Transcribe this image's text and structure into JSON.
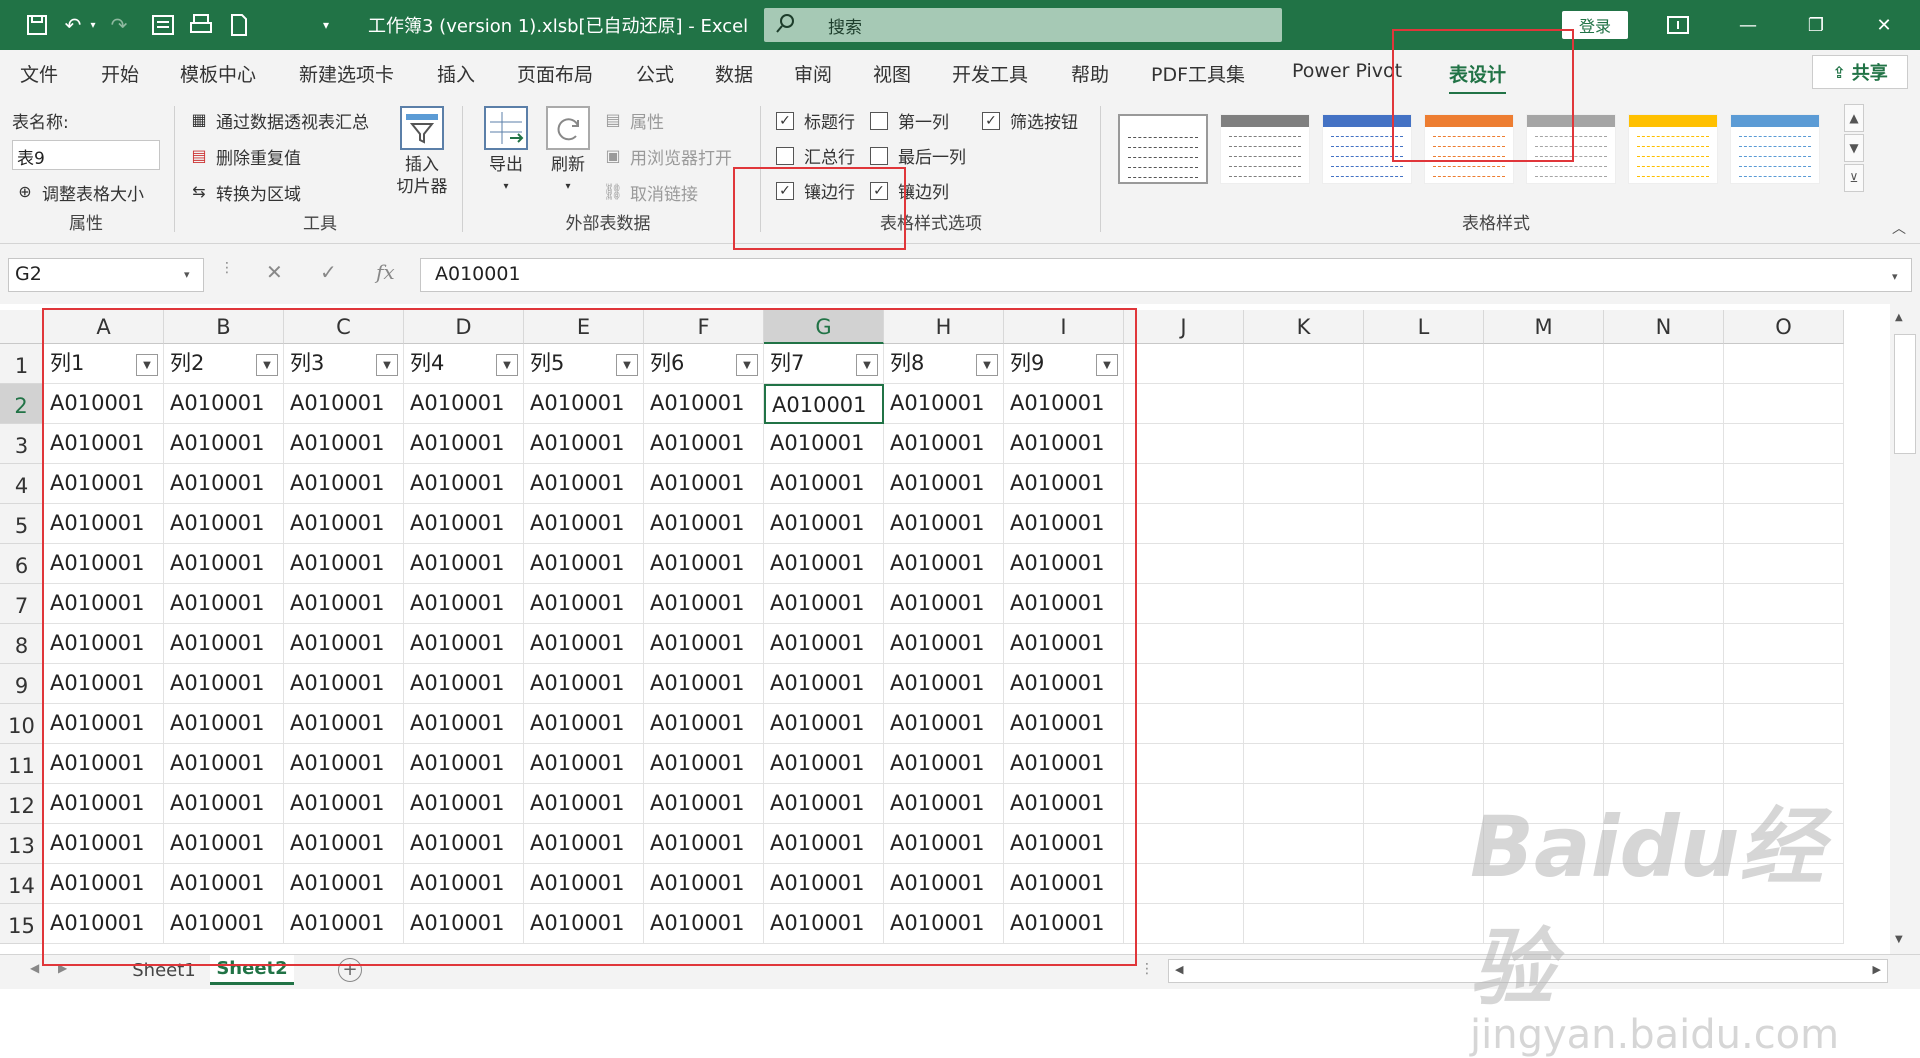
{
  "window": {
    "title": "工作簿3 (version 1).xlsb[已自动还原]  -  Excel",
    "search_placeholder": "搜索",
    "login_label": "登录"
  },
  "tabs": [
    "文件",
    "开始",
    "模板中心",
    "新建选项卡",
    "插入",
    "页面布局",
    "公式",
    "数据",
    "审阅",
    "视图",
    "开发工具",
    "帮助",
    "PDF工具集",
    "Power Pivot",
    "表设计"
  ],
  "share_label": "共享",
  "ribbon": {
    "properties": {
      "table_name_label": "表名称:",
      "table_name_value": "表9",
      "resize_label": "调整表格大小",
      "group_label": "属性"
    },
    "tools": {
      "pivot_label": "通过数据透视表汇总",
      "remove_dup_label": "删除重复值",
      "convert_label": "转换为区域",
      "slicer_label_1": "插入",
      "slicer_label_2": "切片器",
      "group_label": "工具"
    },
    "external": {
      "export_label": "导出",
      "refresh_label": "刷新",
      "properties_label": "属性",
      "browser_label": "用浏览器打开",
      "unlink_label": "取消链接",
      "group_label": "外部表数据"
    },
    "style_options": {
      "header_row": "标题行",
      "total_row": "汇总行",
      "banded_rows": "镶边行",
      "first_col": "第一列",
      "last_col": "最后一列",
      "banded_cols": "镶边列",
      "filter_btn": "筛选按钮",
      "header_row_checked": true,
      "total_row_checked": false,
      "banded_rows_checked": true,
      "first_col_checked": false,
      "last_col_checked": false,
      "banded_cols_checked": true,
      "filter_btn_checked": true,
      "group_label": "表格样式选项"
    },
    "styles": {
      "group_label": "表格样式",
      "swatch_colors": [
        "#ffffff",
        "#7f7f7f",
        "#4472c4",
        "#ed7d31",
        "#a5a5a5",
        "#ffc000",
        "#5b9bd5"
      ]
    }
  },
  "formula_bar": {
    "name_box": "G2",
    "formula": "A010001"
  },
  "grid": {
    "columns": [
      "A",
      "B",
      "C",
      "D",
      "E",
      "F",
      "G",
      "H",
      "I",
      "J",
      "K",
      "L",
      "M",
      "N",
      "O"
    ],
    "selected_col": "G",
    "rows": [
      "1",
      "2",
      "3",
      "4",
      "5",
      "6",
      "7",
      "8",
      "9",
      "10",
      "11",
      "12",
      "13",
      "14",
      "15"
    ],
    "selected_row": "2",
    "headers": [
      "列1",
      "列2",
      "列3",
      "列4",
      "列5",
      "列6",
      "列7",
      "列8",
      "列9"
    ],
    "cell_value": "A010001",
    "active_cell": "G2"
  },
  "sheets": [
    "Sheet1",
    "Sheet2"
  ],
  "active_sheet": "Sheet2",
  "watermark": {
    "main": "Baidu经验",
    "sub": "jingyan.baidu.com"
  }
}
